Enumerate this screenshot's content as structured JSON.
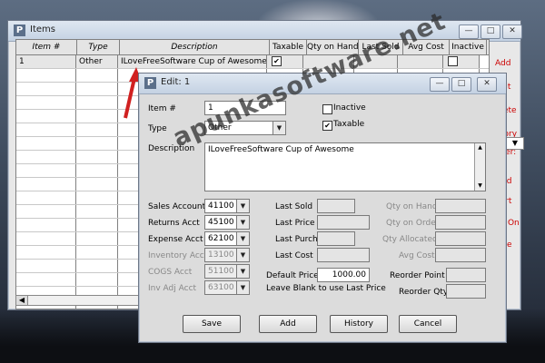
{
  "items_window": {
    "title": "Items",
    "columns": [
      "Item #",
      "Type",
      "Description",
      "Taxable",
      "Qty on Hand",
      "Last Sold",
      "Avg Cost",
      "Inactive"
    ],
    "rows": [
      {
        "item": "1",
        "type": "Other",
        "description": "ILoveFreeSoftware Cup of Awesome",
        "taxable": "✔"
      }
    ],
    "side_links": [
      {
        "label": "Add",
        "accel": "A"
      },
      {
        "label": "Edit",
        "accel": "E"
      },
      {
        "label": "Delete",
        "accel": "D"
      },
      {
        "label": "History",
        "accel": "H"
      },
      {
        "label": "Filter:",
        "accel": "F"
      },
      {
        "label": "Find",
        "accel": "F"
      },
      {
        "label": "Sort",
        "accel": "S"
      },
      {
        "label": "Look On",
        "accel": "O"
      },
      {
        "label": "Close",
        "accel": "C"
      }
    ],
    "scroll_left": "◀"
  },
  "edit_dialog": {
    "title": "Edit: 1",
    "item_label": "Item #",
    "item_value": "1",
    "type_label": "Type",
    "type_value": "Other",
    "inactive_label": "Inactive",
    "taxable_label": "Taxable",
    "taxable_checked": "✔",
    "description_label": "Description",
    "description_value": "ILoveFreeSoftware Cup of Awesome",
    "sales_account_label": "Sales Account",
    "sales_account_value": "41100",
    "returns_acct_label": "Returns Acct",
    "returns_acct_value": "45100",
    "expense_acct_label": "Expense Acct",
    "expense_acct_value": "62100",
    "inventory_acct_label": "Inventory Acct",
    "inventory_acct_value": "13100",
    "cogs_acct_label": "COGS Acct",
    "cogs_acct_value": "51100",
    "inv_adj_acct_label": "Inv Adj Acct",
    "inv_adj_acct_value": "63100",
    "last_sold_label": "Last Sold",
    "last_price_label": "Last Price",
    "last_purch_label": "Last Purch",
    "last_cost_label": "Last Cost",
    "default_price_label": "Default Price",
    "default_price_value": "1000.00",
    "blank_note": "Leave Blank to use Last Price",
    "qty_on_hand_label": "Qty on Hand",
    "qty_on_order_label": "Qty on Order",
    "qty_allocated_label": "Qty Allocated",
    "avg_cost_label": "Avg Cost",
    "reorder_point_label": "Reorder Point",
    "reorder_qty_label": "Reorder Qty",
    "buttons": {
      "save": "Save",
      "add": "Add",
      "history": "History",
      "cancel": "Cancel"
    }
  },
  "watermark": "apunkasoftware.net",
  "colors": {
    "link_red": "#cc0000",
    "arrow_red": "#d02020",
    "title_bar": "#c4d2e3"
  }
}
